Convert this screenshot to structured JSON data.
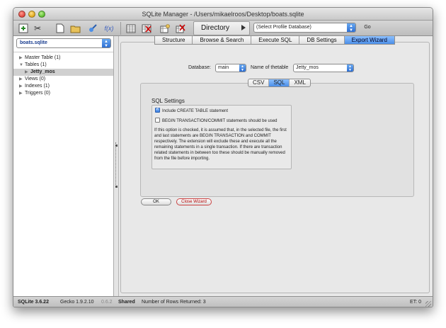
{
  "window": {
    "title": "SQLite Manager - /Users/mikaelroos/Desktop/boats.sqlite"
  },
  "toolbar": {
    "icons": [
      "database-icon",
      "scissors-icon",
      "new-file-icon",
      "open-folder-icon",
      "attach-icon",
      "function-icon",
      "table-icon",
      "delete-table-icon",
      "index-icon",
      "delete-index-icon"
    ],
    "function_label": "f(x)",
    "directory_label": "Directory",
    "profile_select": "(Select Profile Database)",
    "go_label": "Go"
  },
  "sidebar": {
    "db_select": "boats.sqlite",
    "tree": [
      {
        "label": "Master Table (1)",
        "level": 0,
        "expanded": false
      },
      {
        "label": "Tables (1)",
        "level": 0,
        "expanded": true
      },
      {
        "label": "Jetty_mos",
        "level": 1,
        "expanded": false,
        "selected": true
      },
      {
        "label": "Views (0)",
        "level": 0,
        "expanded": false
      },
      {
        "label": "Indexes (1)",
        "level": 0,
        "expanded": false
      },
      {
        "label": "Triggers (0)",
        "level": 0,
        "expanded": false
      }
    ]
  },
  "main": {
    "tabs": [
      {
        "label": "Structure",
        "active": false
      },
      {
        "label": "Browse & Search",
        "active": false
      },
      {
        "label": "Execute SQL",
        "active": false
      },
      {
        "label": "DB Settings",
        "active": false
      },
      {
        "label": "Export Wizard",
        "active": true
      }
    ],
    "database_label": "Database:",
    "database_value": "main",
    "table_label": "Name of thetable",
    "table_value": "Jetty_mos",
    "format_tabs": [
      {
        "label": "CSV",
        "active": false
      },
      {
        "label": "SQL",
        "active": true
      },
      {
        "label": "XML",
        "active": false
      }
    ],
    "sql_settings_title": "SQL Settings",
    "checkbox_create_table": {
      "label": "Include CREATE TABLE statement",
      "checked": true
    },
    "checkbox_transaction": {
      "label": "BEGIN TRANSACTION/COMMIT statements should be used",
      "checked": false
    },
    "help_text": "If this option is checked, it is assumed that, in the selected file, the first and last statements are BEGIN TRANSACTION and COMMIT respectively. The extension will exclude these and execute all the remaining statements in a single transaction. If there are transaction related statements in between too these should be manually removed from the file before importing.",
    "ok_label": "OK",
    "close_label": "Close Wizard"
  },
  "status": {
    "sqlite_version": "SQLite 3.6.22",
    "gecko_version": "Gecko 1.9.2.10",
    "ext_version": "0.6.2",
    "mode": "Shared",
    "rows_returned": "Number of Rows Returned: 3",
    "et": "ET: 0"
  },
  "colors": {
    "accent": "#4b8fe8",
    "close_button": "#b00000",
    "db_name": "#1a3d8f"
  }
}
